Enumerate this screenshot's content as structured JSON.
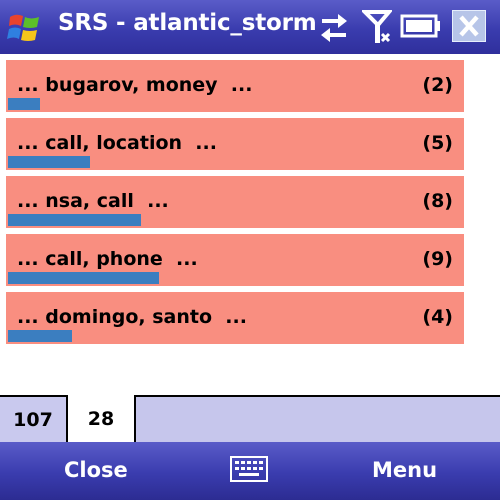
{
  "titlebar": {
    "title": "SRS - atlantic_storm",
    "icons": [
      "windows-start-icon",
      "sync-icon",
      "signal-icon",
      "battery-icon",
      "close-icon"
    ],
    "colors": {
      "bar": "#3a3cae",
      "text": "#ffffff"
    }
  },
  "list": {
    "items": [
      {
        "label": "... bugarov, money  ...",
        "count": "(2)",
        "bar_fraction": 0.07
      },
      {
        "label": "... call, location  ...",
        "count": "(5)",
        "bar_fraction": 0.18
      },
      {
        "label": "... nsa, call  ...",
        "count": "(8)",
        "bar_fraction": 0.29
      },
      {
        "label": "... call, phone  ...",
        "count": "(9)",
        "bar_fraction": 0.33
      },
      {
        "label": "... domingo, santo  ...",
        "count": "(4)",
        "bar_fraction": 0.14
      }
    ],
    "colors": {
      "row": "#f98e80",
      "bar": "#3b7ec0"
    }
  },
  "tabs": [
    {
      "label": "107",
      "selected": false
    },
    {
      "label": "28",
      "selected": true
    }
  ],
  "softkeys": {
    "left_label": "Close",
    "right_label": "Menu",
    "center_icon": "keyboard-icon"
  }
}
